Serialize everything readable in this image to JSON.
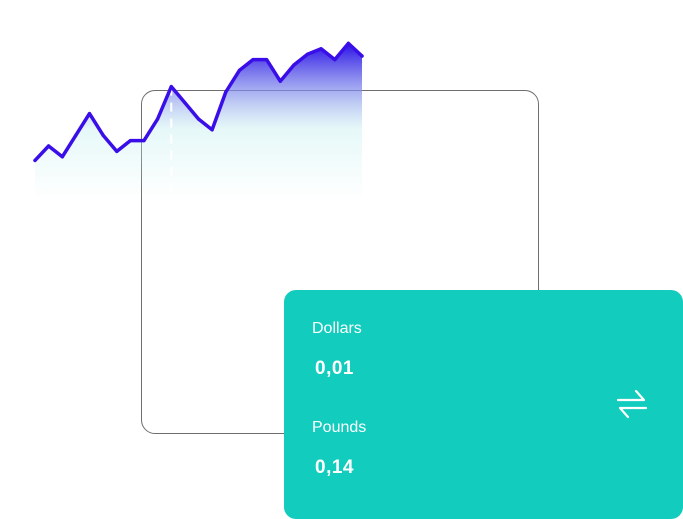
{
  "chart_data": {
    "type": "area",
    "series": [
      {
        "values": [
          22,
          30,
          24,
          36,
          48,
          36,
          27,
          33,
          33,
          45,
          63,
          54,
          45,
          39,
          60,
          72,
          78,
          78,
          66,
          75,
          81,
          84,
          78,
          87,
          80
        ]
      }
    ],
    "ylim": [
      0,
      100
    ],
    "line_color": "#3a0ee8",
    "fill_top_color": "#2a10e6",
    "fill_bottom_color": "#c8f0f0",
    "marker_index": 10,
    "marker_style": "dashed-white"
  },
  "converter": {
    "from_label": "Dollars",
    "from_value": "0,01",
    "to_label": "Pounds",
    "to_value": "0,14",
    "swap_icon": "swap-arrows-icon",
    "background_color": "#12ccbe"
  }
}
